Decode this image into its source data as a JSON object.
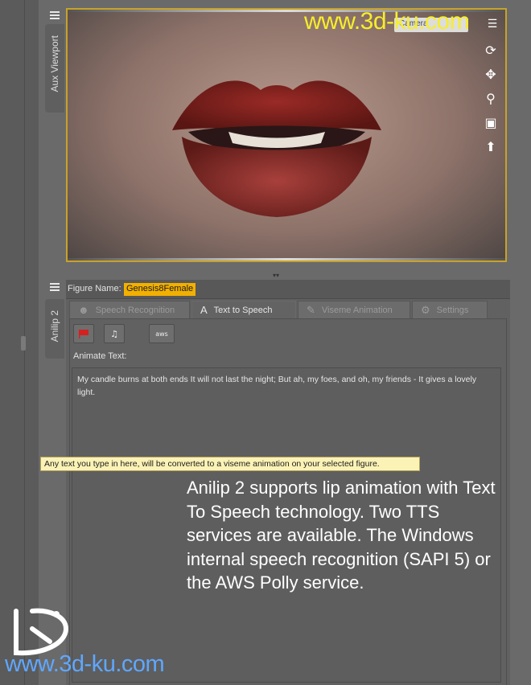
{
  "aux_viewport": {
    "tab_label": "Aux Viewport",
    "camera_select": "Camera"
  },
  "anilip": {
    "tab_label": "Anilip 2"
  },
  "figure": {
    "label": "Figure Name:",
    "value": "Genesis8Female"
  },
  "tabs": [
    {
      "label": "Speech Recognition",
      "icon": "person-icon"
    },
    {
      "label": "Text to Speech",
      "icon": "letter-a-icon",
      "active": true
    },
    {
      "label": "Viseme Animation",
      "icon": "figure-icon"
    },
    {
      "label": "Settings",
      "icon": "gear-icon"
    }
  ],
  "toolbar": {
    "aws_label": "aws"
  },
  "animate_text": {
    "label": "Animate Text:",
    "value": "My candle burns at both ends It will not last the night; But ah, my foes, and oh, my friends - It gives a lovely light."
  },
  "tooltip": "Any text you type in here, will be converted to a viseme animation on your selected figure.",
  "description": "Anilip 2 supports lip animation with Text To Speech technology. Two TTS services are available. The Windows internal speech recognition (SAPI 5) or the AWS Polly service.",
  "watermark": {
    "top": "www.3d-ku.com",
    "bottom": "www.3d-ku.com"
  },
  "colors": {
    "accent": "#f2b000",
    "frame": "#c9a227",
    "tooltip_bg": "#fbf2b6"
  }
}
